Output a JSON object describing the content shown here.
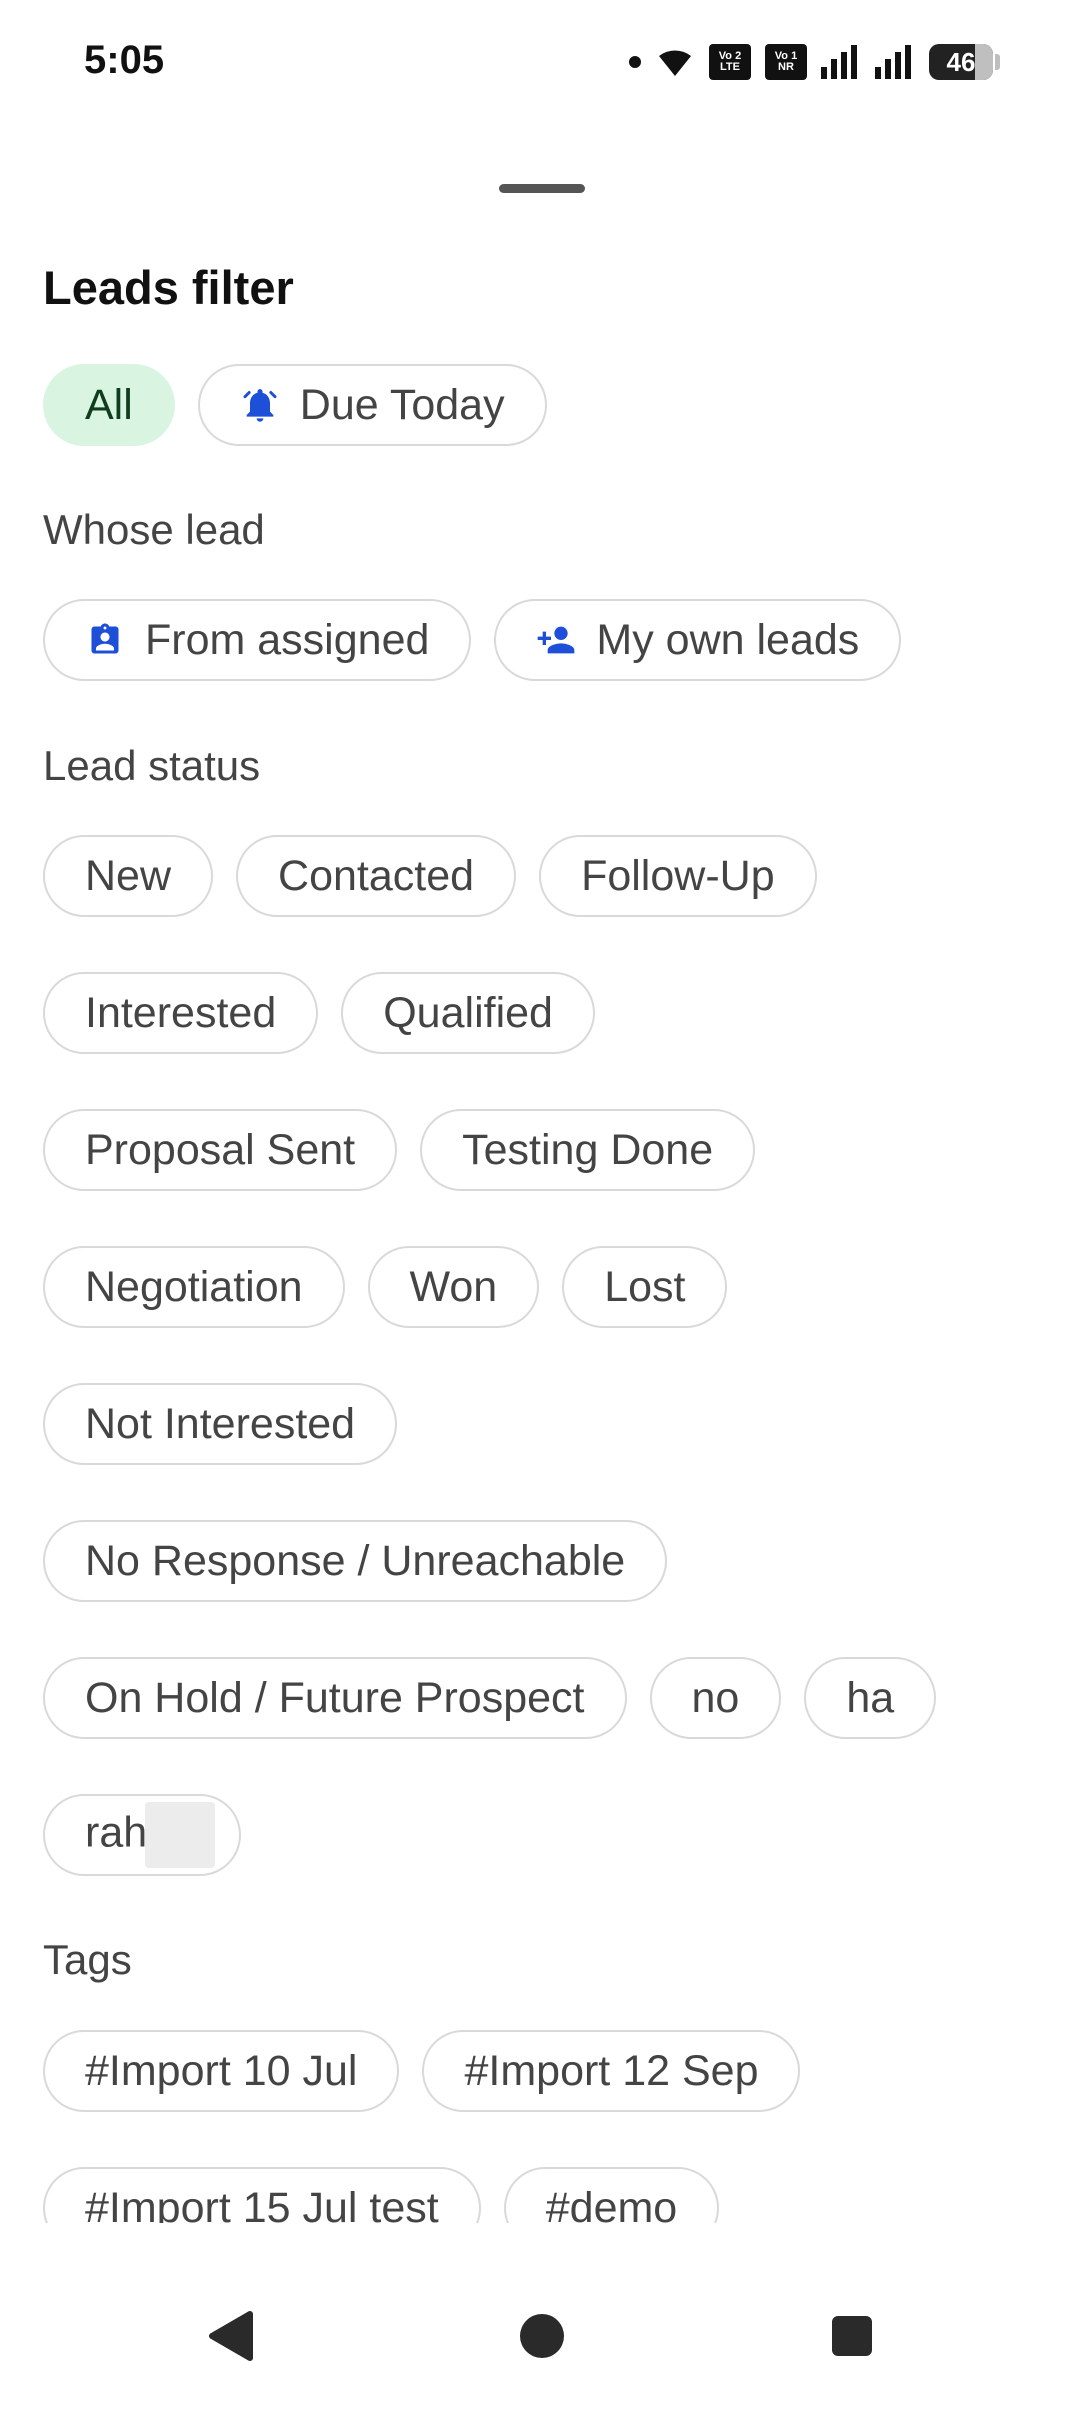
{
  "status_bar": {
    "time": "5:05",
    "sim1": "Vo 2\nLTE",
    "sim2": "Vo 1\nNR",
    "battery": "46"
  },
  "title": "Leads filter",
  "quick_filters": [
    {
      "label": "All",
      "selected": true
    },
    {
      "label": "Due Today",
      "icon": "alarm-bell-icon"
    }
  ],
  "whose_lead": {
    "label": "Whose lead",
    "options": [
      {
        "label": "From assigned",
        "icon": "assignment-ind-icon"
      },
      {
        "label": "My own leads",
        "icon": "person-add-icon"
      }
    ]
  },
  "lead_status": {
    "label": "Lead status",
    "rows": [
      [
        "New",
        "Contacted",
        "Follow-Up"
      ],
      [
        "Interested",
        "Qualified"
      ],
      [
        "Proposal Sent",
        "Testing Done"
      ],
      [
        "Negotiation",
        "Won",
        "Lost"
      ],
      [
        "Not Interested"
      ],
      [
        "No Response / Unreachable"
      ],
      [
        "On Hold / Future Prospect",
        "no",
        "ha"
      ],
      [
        "rah"
      ]
    ]
  },
  "tags": {
    "label": "Tags",
    "rows": [
      [
        "#Import 10 Jul",
        "#Import 12 Sep"
      ],
      [
        "#Import 15 Jul test",
        "#demo"
      ]
    ]
  },
  "colors": {
    "accent_blue": "#1e4fd8",
    "selected_bg": "#d9f5e2",
    "chip_border": "#d9d9d9"
  }
}
